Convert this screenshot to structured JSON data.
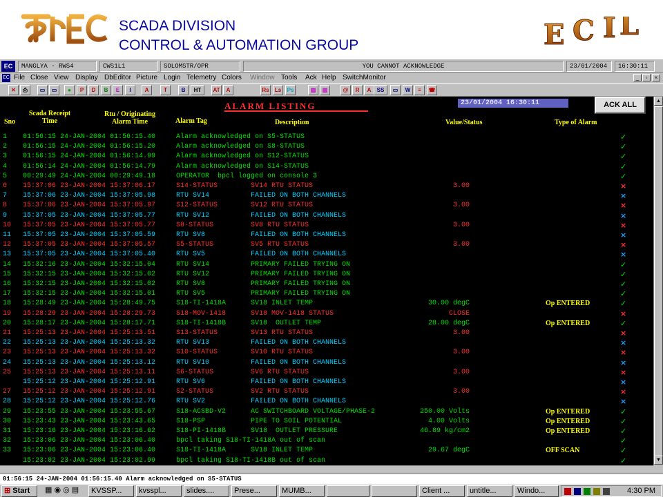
{
  "banner": {
    "logo_left_text": "इका ECI",
    "line1": "SCADA DIVISION",
    "line2": "CONTROL & AUTOMATION GROUP",
    "logo_right_text": "E C I L"
  },
  "infobar": {
    "site": "MANGLYA - RWS4",
    "station": "CWS1L1",
    "user": "SOLOMSTR/OPR",
    "message": "YOU CANNOT ACKNOWLEDGE",
    "date": "23/01/2004",
    "time": "16:30:11"
  },
  "menu": {
    "items": [
      "File",
      "Close",
      "View",
      "Display",
      "DbEditor",
      "Picture",
      "Login",
      "Telemetry",
      "Colors",
      "Window",
      "Tools",
      "Ack",
      "Help",
      "SwitchMonitor"
    ]
  },
  "toolbar": {
    "buttons": [
      "X",
      "print",
      "screen",
      "screen2",
      "dot",
      "P",
      "D",
      "B",
      "E",
      "I",
      "A",
      "T",
      "B",
      "HT",
      "AT",
      "A",
      "Rs",
      "Ls",
      "Ps",
      "chart",
      "chart2",
      "@",
      "R",
      "A",
      "I",
      "SS",
      "monitor",
      "W",
      "list",
      "phone"
    ]
  },
  "listing": {
    "title": "ALARM LISTING",
    "datetime": "23/01/2004  16:30:11",
    "ack_all": "ACK ALL",
    "headers": {
      "sno": "Sno",
      "receipt": "Scada Receipt\nTime",
      "rtu": "Rtu / Originating\nAlarm Time",
      "tag": "Alarm Tag",
      "desc": "Description",
      "value": "Value/Status",
      "type": "Type of Alarm"
    },
    "rows": [
      {
        "sno": "1",
        "t1": "01:56:15 24-JAN-2004 01:56:15.40",
        "tag": "Alarm acknowledged on S5-STATUS",
        "desc": "",
        "value": "",
        "type": "",
        "color": "green",
        "mark": "✓",
        "mark_class": "mark-ok"
      },
      {
        "sno": "2",
        "t1": "01:56:15 24-JAN-2004 01:56:15.20",
        "tag": "Alarm acknowledged on S8-STATUS",
        "desc": "",
        "value": "",
        "type": "",
        "color": "green",
        "mark": "✓",
        "mark_class": "mark-ok"
      },
      {
        "sno": "3",
        "t1": "01:56:15 24-JAN-2004 01:56:14.99",
        "tag": "Alarm acknowledged on S12-STATUS",
        "desc": "",
        "value": "",
        "type": "",
        "color": "green",
        "mark": "✓",
        "mark_class": "mark-ok"
      },
      {
        "sno": "4",
        "t1": "01:56:14 24-JAN-2004 01:56:14.79",
        "tag": "Alarm acknowledged on S14-STATUS",
        "desc": "",
        "value": "",
        "type": "",
        "color": "green",
        "mark": "✓",
        "mark_class": "mark-ok"
      },
      {
        "sno": "5",
        "t1": "00:29:49 24-JAN-2004 00:29:49.18",
        "tag": "OPERATOR  bpcl logged on console 3",
        "desc": "",
        "value": "",
        "type": "",
        "color": "green",
        "mark": "✓",
        "mark_class": "mark-ok"
      },
      {
        "sno": "6",
        "t1": "15:37:06 23-JAN-2004 15:37:06.17",
        "tag": "S14-STATUS",
        "desc": "SV14 RTU STATUS",
        "value": "3.00",
        "type": "",
        "color": "red",
        "mark": "×",
        "mark_class": "mark-x"
      },
      {
        "sno": "7",
        "t1": "15:37:06 23-JAN-2004 15:37:05.98",
        "tag": "RTU SV14",
        "desc": "FAILED ON BOTH CHANNELS",
        "value": "",
        "type": "",
        "color": "cyan",
        "mark": "×",
        "mark_class": "mark-b"
      },
      {
        "sno": "8",
        "t1": "15:37:06 23-JAN-2004 15:37:05.97",
        "tag": "S12-STATUS",
        "desc": "SV12 RTU STATUS",
        "value": "3.00",
        "type": "",
        "color": "red",
        "mark": "×",
        "mark_class": "mark-x"
      },
      {
        "sno": "9",
        "t1": "15:37:05 23-JAN-2004 15:37:05.77",
        "tag": "RTU SV12",
        "desc": "FAILED ON BOTH CHANNELS",
        "value": "",
        "type": "",
        "color": "cyan",
        "mark": "×",
        "mark_class": "mark-b"
      },
      {
        "sno": "10",
        "t1": "15:37:05 23-JAN-2004 15:37:05.77",
        "tag": "S8-STATUS",
        "desc": "SV8 RTU STATUS",
        "value": "3.00",
        "type": "",
        "color": "red",
        "mark": "×",
        "mark_class": "mark-x"
      },
      {
        "sno": "11",
        "t1": "15:37:05 23-JAN-2004 15:37:05.59",
        "tag": "RTU SV8",
        "desc": "FAILED ON BOTH CHANNELS",
        "value": "",
        "type": "",
        "color": "cyan",
        "mark": "×",
        "mark_class": "mark-b"
      },
      {
        "sno": "12",
        "t1": "15:37:05 23-JAN-2004 15:37:05.57",
        "tag": "S5-STATUS",
        "desc": "SV5 RTU STATUS",
        "value": "3.00",
        "type": "",
        "color": "red",
        "mark": "×",
        "mark_class": "mark-x"
      },
      {
        "sno": "13",
        "t1": "15:37:05 23-JAN-2004 15:37:05.40",
        "tag": "RTU SV5",
        "desc": "FAILED ON BOTH CHANNELS",
        "value": "",
        "type": "",
        "color": "cyan",
        "mark": "×",
        "mark_class": "mark-b"
      },
      {
        "sno": "14",
        "t1": "15:32:16 23-JAN-2004 15:32:15.04",
        "tag": "RTU SV14",
        "desc": "PRIMARY FAILED TRYING ON",
        "value": "",
        "type": "",
        "color": "green",
        "mark": "✓",
        "mark_class": "mark-ok"
      },
      {
        "sno": "15",
        "t1": "15:32:15 23-JAN-2004 15:32:15.02",
        "tag": "RTU SV12",
        "desc": "PRIMARY FAILED TRYING ON",
        "value": "",
        "type": "",
        "color": "green",
        "mark": "✓",
        "mark_class": "mark-ok"
      },
      {
        "sno": "16",
        "t1": "15:32:15 23-JAN-2004 15:32:15.02",
        "tag": "RTU SV8",
        "desc": "PRIMARY FAILED TRYING ON",
        "value": "",
        "type": "",
        "color": "green",
        "mark": "✓",
        "mark_class": "mark-ok"
      },
      {
        "sno": "17",
        "t1": "15:32:15 23-JAN-2004 15:32:15.01",
        "tag": "RTU SV5",
        "desc": "PRIMARY FAILED TRYING ON",
        "value": "",
        "type": "",
        "color": "green",
        "mark": "✓",
        "mark_class": "mark-ok"
      },
      {
        "sno": "18",
        "t1": "15:28:49 23-JAN-2004 15:28:49.75",
        "tag": "S18-TI-1418A",
        "desc": "SV18 INLET TEMP",
        "value": "30.00 degC",
        "type": "Op ENTERED",
        "color": "green",
        "mark": "✓",
        "mark_class": "mark-ok"
      },
      {
        "sno": "19",
        "t1": "15:28:29 23-JAN-2004 15:28:29.73",
        "tag": "S18-MOV-1418",
        "desc": "SV18 MOV-1418 STATUS",
        "value": "CLOSE",
        "type": "",
        "color": "red",
        "mark": "×",
        "mark_class": "mark-x"
      },
      {
        "sno": "20",
        "t1": "15:28:17 23-JAN-2004 15:28:17.71",
        "tag": "S18-TI-1418B",
        "desc": "SV18  OUTLET TEMP",
        "value": "28.00 degC",
        "type": "Op ENTERED",
        "color": "green",
        "mark": "✓",
        "mark_class": "mark-ok"
      },
      {
        "sno": "21",
        "t1": "15:25:13 23-JAN-2004 15:25:13.51",
        "tag": "S13-STATUS",
        "desc": "SV13 RTU STATUS",
        "value": "3.00",
        "type": "",
        "color": "red",
        "mark": "×",
        "mark_class": "mark-x"
      },
      {
        "sno": "22",
        "t1": "15:25:13 23-JAN-2004 15:25:13.32",
        "tag": "RTU SV13",
        "desc": "FAILED ON BOTH CHANNELS",
        "value": "",
        "type": "",
        "color": "cyan",
        "mark": "×",
        "mark_class": "mark-b"
      },
      {
        "sno": "23",
        "t1": "15:25:13 23-JAN-2004 15:25:13.32",
        "tag": "S10-STATUS",
        "desc": "SV10 RTU STATUS",
        "value": "3.00",
        "type": "",
        "color": "red",
        "mark": "×",
        "mark_class": "mark-x"
      },
      {
        "sno": "24",
        "t1": "15:25:13 23-JAN-2004 15:25:13.12",
        "tag": "RTU SV10",
        "desc": "FAILED ON BOTH CHANNELS",
        "value": "",
        "type": "",
        "color": "cyan",
        "mark": "×",
        "mark_class": "mark-b"
      },
      {
        "sno": "25",
        "t1": "15:25:13 23-JAN-2004 15:25:13.11",
        "tag": "S6-STATUS",
        "desc": "SV6 RTU STATUS",
        "value": "3.00",
        "type": "",
        "color": "red",
        "mark": "×",
        "mark_class": "mark-x"
      },
      {
        "sno": "",
        "t1": "15:25:12 23-JAN-2004 15:25:12.91",
        "tag": "RTU SV6",
        "desc": "FAILED ON BOTH CHANNELS",
        "value": "",
        "type": "",
        "color": "cyan",
        "mark": "×",
        "mark_class": "mark-b"
      },
      {
        "sno": "27",
        "t1": "15:25:12 23-JAN-2004 15:25:12.91",
        "tag": "S2-STATUS",
        "desc": "SV2 RTU STATUS",
        "value": "3.00",
        "type": "",
        "color": "red",
        "mark": "×",
        "mark_class": "mark-x"
      },
      {
        "sno": "28",
        "t1": "15:25:12 23-JAN-2004 15:25:12.76",
        "tag": "RTU SV2",
        "desc": "FAILED ON BOTH CHANNELS",
        "value": "",
        "type": "",
        "color": "cyan",
        "mark": "×",
        "mark_class": "mark-b"
      },
      {
        "sno": "29",
        "t1": "15:23:55 23-JAN-2004 15:23:55.67",
        "tag": "S18-ACSBD-V2",
        "desc": "AC SWITCHBOARD VOLTAGE/PHASE-2",
        "value": "250.00 Volts",
        "type": "Op ENTERED",
        "color": "green",
        "mark": "✓",
        "mark_class": "mark-ok"
      },
      {
        "sno": "30",
        "t1": "15:23:43 23-JAN-2004 15:23:43.65",
        "tag": "S18-PSP",
        "desc": "PIPE TO SOIL POTENTIAL",
        "value": "4.00 Volts",
        "type": "Op ENTERED",
        "color": "green",
        "mark": "✓",
        "mark_class": "mark-ok"
      },
      {
        "sno": "31",
        "t1": "15:23:16 23-JAN-2004 15:23:16.62",
        "tag": "S18-PI-1418B",
        "desc": "SV18  OUTLET PRESSURE",
        "value": "46.89 kg/cm2",
        "type": "Op ENTERED",
        "color": "green",
        "mark": "✓",
        "mark_class": "mark-ok"
      },
      {
        "sno": "32",
        "t1": "15:23:06 23-JAN-2004 15:23:06.40",
        "tag": "bpcl taking S18-TI-1418A out of scan",
        "desc": "",
        "value": "",
        "type": "",
        "color": "green",
        "mark": "✓",
        "mark_class": "mark-ok"
      },
      {
        "sno": "33",
        "t1": "15:23:06 23-JAN-2004 15:23:06.40",
        "tag": "S18-TI-1418A",
        "desc": "SV18 INLET TEMP",
        "value": "29.67 degC",
        "type": "OFF SCAN",
        "color": "green",
        "mark": "✓",
        "mark_class": "mark-ok"
      },
      {
        "sno": "",
        "t1": "15:23:02 23-JAN-2004 15:23:02.99",
        "tag": "bpcl taking S18-TI-1418B out of scan",
        "desc": "",
        "value": "",
        "type": "",
        "color": "green",
        "mark": "✓",
        "mark_class": "mark-ok"
      }
    ]
  },
  "statusbar": {
    "text": "01:56:15 24-JAN-2004 01:56:15.40 Alarm acknowledged on S5-STATUS"
  },
  "taskbar": {
    "start": "Start",
    "tasks": [
      "KVSSP...",
      "kvsspl...",
      "slides....",
      "Prese...",
      "MUMB...",
      "",
      "",
      "Client ...",
      "untitle...",
      "Windo..."
    ],
    "clock": "4:30 PM"
  },
  "colors": {
    "pane_bg": "#000000",
    "green": "#00e000",
    "red": "#ff3030",
    "cyan": "#00d0ff",
    "header_yellow": "#ffff00",
    "banner_blue": "#0a0aa0",
    "logo_orange": "#d07010"
  }
}
